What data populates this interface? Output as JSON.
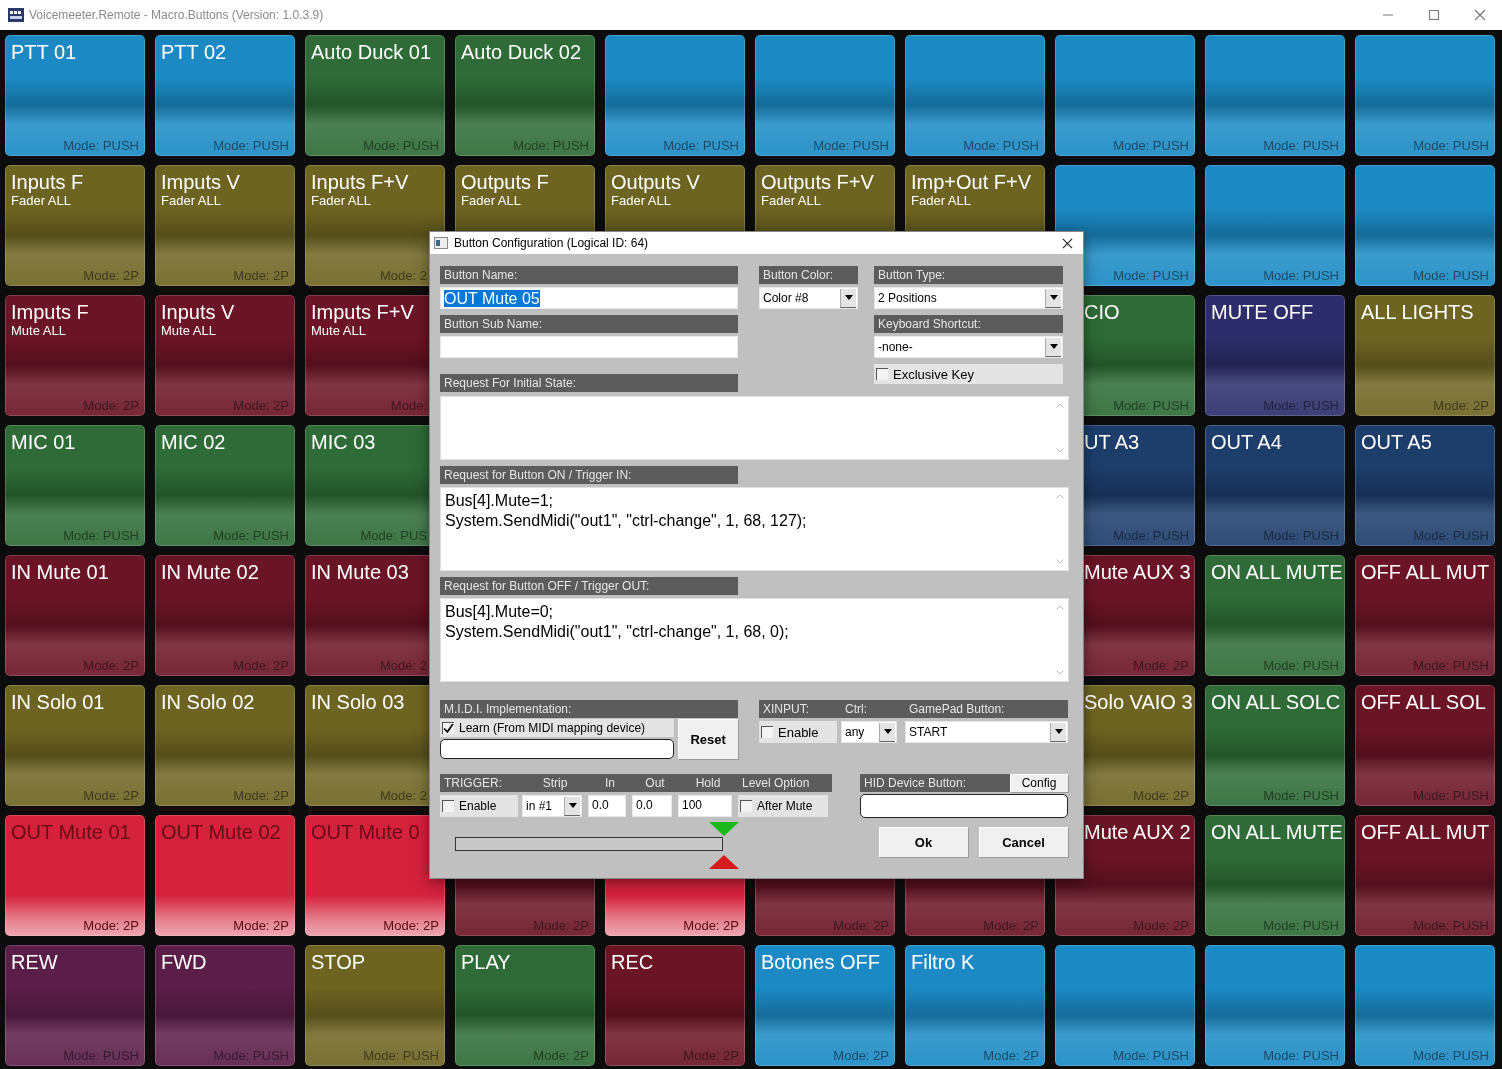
{
  "window": {
    "title": "Voicemeeter.Remote - Macro.Buttons (Version: 1.0.3.9)"
  },
  "grid": {
    "rows": [
      {
        "cells": [
          {
            "title": "PTT 01",
            "mode": "Mode: PUSH",
            "color": "#1b8ac4",
            "on": false
          },
          {
            "title": "PTT 02",
            "mode": "Mode: PUSH",
            "color": "#1b8ac4",
            "on": false
          },
          {
            "title": "Auto Duck 01",
            "mode": "Mode: PUSH",
            "color": "#2e6b36",
            "on": false
          },
          {
            "title": "Auto Duck 02",
            "mode": "Mode: PUSH",
            "color": "#2e6b36",
            "on": false
          },
          {
            "mode": "Mode: PUSH",
            "color": "#1b8ac4",
            "on": false
          },
          {
            "mode": "Mode: PUSH",
            "color": "#1b8ac4",
            "on": false
          },
          {
            "mode": "Mode: PUSH",
            "color": "#1b8ac4",
            "on": false
          },
          {
            "mode": "Mode: PUSH",
            "color": "#1b8ac4",
            "on": false
          },
          {
            "mode": "Mode: PUSH",
            "color": "#1b8ac4",
            "on": false
          },
          {
            "mode": "Mode: PUSH",
            "color": "#1b8ac4",
            "on": false
          }
        ]
      },
      {
        "cells": [
          {
            "title": "Inputs F",
            "subtitle": "Fader ALL",
            "mode": "Mode: 2P",
            "color": "#6e6422",
            "on": false
          },
          {
            "title": "Imputs V",
            "subtitle": "Fader ALL",
            "mode": "Mode: 2P",
            "color": "#6e6422",
            "on": false
          },
          {
            "title": "Inputs F+V",
            "subtitle": "Fader ALL",
            "mode": "Mode: 2",
            "color": "#6e6422",
            "on": false
          },
          {
            "title": "Outputs F",
            "subtitle": "Fader ALL",
            "color": "#6e6422",
            "on": false
          },
          {
            "title": "Outputs V",
            "subtitle": "Fader ALL",
            "color": "#6e6422",
            "on": false
          },
          {
            "title": "Outputs F+V",
            "subtitle": "Fader ALL",
            "color": "#6e6422",
            "on": false
          },
          {
            "title": "Imp+Out F+V",
            "subtitle": "Fader ALL",
            "color": "#6e6422",
            "on": false
          },
          {
            "mode": "Mode: PUSH",
            "color": "#1b8ac4",
            "on": false
          },
          {
            "mode": "Mode: PUSH",
            "color": "#1b8ac4",
            "on": false
          },
          {
            "mode": "Mode: PUSH",
            "color": "#1b8ac4",
            "on": false
          }
        ]
      },
      {
        "cells": [
          {
            "title": "Imputs F",
            "subtitle": "Mute ALL",
            "mode": "Mode: 2P",
            "color": "#6b1426",
            "on": false
          },
          {
            "title": "Inputs V",
            "subtitle": "Mute ALL",
            "mode": "Mode: 2P",
            "color": "#6b1426",
            "on": false
          },
          {
            "title": "Imputs F+V",
            "subtitle": "Mute ALL",
            "mode": "Mode:",
            "color": "#6b1426",
            "on": false
          },
          {
            "title": "CIO",
            "mode": "Mode: PUSH",
            "color": "#2e6b36",
            "on": false
          },
          {
            "title": "MUTE OFF",
            "mode": "Mode: PUSH",
            "color": "#2c2d6a",
            "on": false
          },
          {
            "title": "ALL LIGHTS",
            "mode": "Mode: 2P",
            "color": "#6e6422",
            "on": false
          }
        ]
      },
      {
        "cells": [
          {
            "title": "MIC 01",
            "mode": "Mode: PUSH",
            "color": "#2e6b36",
            "on": false
          },
          {
            "title": "MIC 02",
            "mode": "Mode: PUSH",
            "color": "#2e6b36",
            "on": false
          },
          {
            "title": "MIC 03",
            "mode": "Mode: PUS",
            "color": "#2e6b36",
            "on": false
          },
          {
            "title": "UT A3",
            "mode": "Mode: PUSH",
            "color": "#1d3d6b",
            "on": false
          },
          {
            "title": "OUT A4",
            "mode": "Mode: PUSH",
            "color": "#1d3d6b",
            "on": false
          },
          {
            "title": "OUT A5",
            "mode": "Mode: PUSH",
            "color": "#1d3d6b",
            "on": false
          }
        ]
      },
      {
        "cells": [
          {
            "title": "IN Mute 01",
            "mode": "Mode: 2P",
            "color": "#6b1426",
            "on": false
          },
          {
            "title": "IN Mute 02",
            "mode": "Mode: 2P",
            "color": "#6b1426",
            "on": false
          },
          {
            "title": "IN Mute 03",
            "mode": "Mode: 2",
            "color": "#6b1426",
            "on": false
          },
          {
            "title": "Mute AUX 3",
            "mode": "Mode: 2P",
            "color": "#6b1426",
            "on": false
          },
          {
            "title": "ON ALL MUTE",
            "mode": "Mode: PUSH",
            "color": "#2e6b36",
            "on": false
          },
          {
            "title": "OFF ALL MUT",
            "mode": "Mode: PUSH",
            "color": "#6b1426",
            "on": false
          }
        ]
      },
      {
        "cells": [
          {
            "title": "IN Solo 01",
            "mode": "Mode: 2P",
            "color": "#6e6422",
            "on": false
          },
          {
            "title": "IN Solo 02",
            "mode": "Mode: 2P",
            "color": "#6e6422",
            "on": false
          },
          {
            "title": "IN Solo 03",
            "mode": "Mode: 2",
            "color": "#6e6422",
            "on": false
          },
          {
            "title": "Solo VAIO 3",
            "mode": "Mode: 2P",
            "color": "#6e6422",
            "on": false
          },
          {
            "title": "ON ALL SOLC",
            "mode": "Mode: PUSH",
            "color": "#2e6b36",
            "on": false
          },
          {
            "title": "OFF ALL SOL",
            "mode": "Mode: PUSH",
            "color": "#6b1426",
            "on": false
          }
        ]
      },
      {
        "cells": [
          {
            "title": "OUT Mute 01",
            "mode": "Mode: 2P",
            "color": "#d4213c",
            "on": true
          },
          {
            "title": "OUT Mute 02",
            "mode": "Mode: 2P",
            "color": "#d4213c",
            "on": true
          },
          {
            "title": "OUT Mute 0",
            "mode": "Mode: 2P",
            "color": "#d4213c",
            "on": true
          },
          {
            "mode": "Mode: 2P",
            "color": "#6b1426",
            "on": false
          },
          {
            "mode": "Mode: 2P",
            "color": "#d4213c",
            "on": true
          },
          {
            "mode": "Mode: 2P",
            "color": "#6b1426",
            "on": false
          },
          {
            "mode": "Mode: 2P",
            "color": "#6b1426",
            "on": false
          },
          {
            "title": "Mute AUX 2",
            "mode": "Mode: 2P",
            "color": "#6b1426",
            "on": false
          },
          {
            "title": "ON ALL MUTE",
            "mode": "Mode: PUSH",
            "color": "#2e6b36",
            "on": false
          },
          {
            "title": "OFF ALL MUT",
            "mode": "Mode: PUSH",
            "color": "#6b1426",
            "on": false
          }
        ]
      },
      {
        "cells": [
          {
            "title": "REW",
            "mode": "Mode: PUSH",
            "color": "#5b1e48",
            "on": false
          },
          {
            "title": "FWD",
            "mode": "Mode: PUSH",
            "color": "#5b1e48",
            "on": false
          },
          {
            "title": "STOP",
            "mode": "Mode: PUSH",
            "color": "#6e6422",
            "on": false
          },
          {
            "title": "PLAY",
            "mode": "Mode: 2P",
            "color": "#2e6b36",
            "on": false
          },
          {
            "title": "REC",
            "mode": "Mode: 2P",
            "color": "#6b1426",
            "on": false
          },
          {
            "title": "Botones OFF",
            "mode": "Mode: 2P",
            "color": "#1b8ac4",
            "on": false
          },
          {
            "title": "Filtro K",
            "mode": "Mode: 2P",
            "color": "#1b8ac4",
            "on": false
          },
          {
            "mode": "Mode: PUSH",
            "color": "#1b8ac4",
            "on": false
          },
          {
            "mode": "Mode: PUSH",
            "color": "#1b8ac4",
            "on": false
          },
          {
            "mode": "Mode: PUSH",
            "color": "#1b8ac4",
            "on": false
          }
        ]
      }
    ]
  },
  "dialog": {
    "title": "Button Configuration (Logical ID: 64)",
    "button_name": {
      "label": "Button Name:",
      "value": "OUT Mute 05"
    },
    "button_sub_name": {
      "label": "Button Sub Name:"
    },
    "button_color": {
      "label": "Button Color:",
      "value": "Color #8"
    },
    "button_type": {
      "label": "Button Type:",
      "value": "2 Positions"
    },
    "keyboard_shortcut": {
      "label": "Keyboard Shortcut:",
      "value": "-none-"
    },
    "exclusive_key": {
      "label": "Exclusive Key",
      "checked": false
    },
    "initial_state": {
      "label": "Request For Initial State:"
    },
    "request_on": {
      "label": "Request for Button ON / Trigger IN:",
      "lines": [
        "Bus[4].Mute=1;",
        "System.SendMidi(\"out1\", \"ctrl-change\", 1, 68, 127);"
      ]
    },
    "request_off": {
      "label": "Request for Button OFF / Trigger OUT:",
      "lines": [
        "Bus[4].Mute=0;",
        "System.SendMidi(\"out1\", \"ctrl-change\", 1, 68, 0);"
      ]
    },
    "midi": {
      "label": "M.I.D.I. Implementation:",
      "learn": {
        "label": "Learn (From MIDI mapping device)",
        "checked": true
      },
      "reset": "Reset"
    },
    "xinput": {
      "headers": [
        "XINPUT:",
        "Ctrl:",
        "GamePad Button:"
      ],
      "enable": {
        "label": "Enable",
        "checked": false
      },
      "ctrl": "any",
      "gamepad_button": "START"
    },
    "trigger": {
      "headers": [
        "TRIGGER:",
        "Strip",
        "In",
        "Out",
        "Hold",
        "Level Option"
      ],
      "enable": {
        "label": "Enable",
        "checked": false
      },
      "strip": "in #1",
      "in": "0.0",
      "out": "0.0",
      "hold": "100",
      "after_mute": {
        "label": "After Mute",
        "checked": false
      }
    },
    "hid": {
      "label": "HID Device Button:",
      "config": "Config"
    },
    "buttons": [
      "Ok",
      "Cancel"
    ]
  }
}
